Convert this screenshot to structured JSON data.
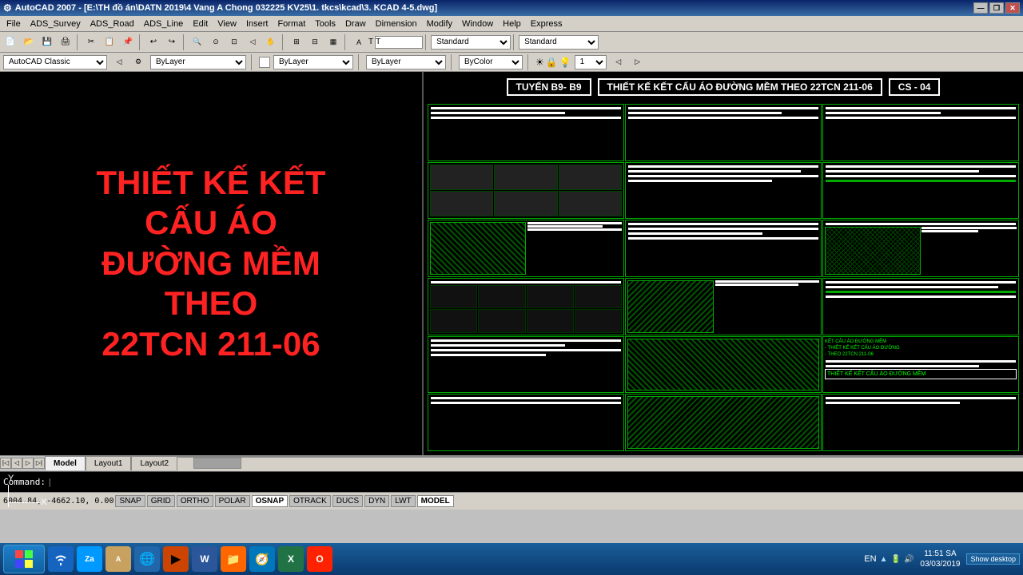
{
  "titlebar": {
    "title": "AutoCAD 2007 - [E:\\TH đồ án\\DATN 2019\\4 Vang A Chong 032225 KV25\\1. tkcs\\kcad\\3. KCAD 4-5.dwg]",
    "icon": "⚙",
    "min": "—",
    "max": "□",
    "close": "✕",
    "restore": "❐"
  },
  "menu": {
    "items": [
      "File",
      "ADS_Survey",
      "ADS_Road",
      "ADS_Line",
      "Edit",
      "View",
      "Insert",
      "Format",
      "Tools",
      "Draw",
      "Dimension",
      "Modify",
      "Window",
      "Help",
      "Express"
    ]
  },
  "toolbar1": {
    "buttons": [
      "📄",
      "📂",
      "💾",
      "🖨",
      "✂",
      "📋",
      "↩",
      "↪",
      "🔍",
      "❓"
    ]
  },
  "propbar": {
    "workspace": "AutoCAD Classic",
    "layer": "ByLayer",
    "color": "ByColor",
    "linetype": "ByLayer",
    "lineweight": "ByLayer",
    "plot": "1"
  },
  "drawing": {
    "left_text_lines": [
      "THIẾT KẾ KẾT",
      "CẤU ÁO",
      "ĐƯỜNG MỀM",
      "THEO",
      "22TCN 211-06"
    ],
    "header": {
      "badge1": "TUYẾN B9- B9",
      "title": "THIẾT KẾ KẾT CẤU ÁO ĐƯỜNG MỀM THEO 22TCN 211-06",
      "badge2": "CS - 04"
    }
  },
  "tabs": {
    "items": [
      "Model",
      "Layout1",
      "Layout2"
    ]
  },
  "cmdline": {
    "prompt": "Command:"
  },
  "statusbar": {
    "coords": "6004.84, -4662.10, 0.00",
    "buttons": [
      "SNAP",
      "GRID",
      "ORTHO",
      "POLAR",
      "OSNAP",
      "OTRACK",
      "DUCS",
      "DYN",
      "LWT",
      "MODEL"
    ]
  },
  "taskbar": {
    "win_icon": "⊞",
    "apps": [
      "wifi",
      "zalo",
      "recycle",
      "clock",
      "firefox",
      "vlc",
      "word",
      "finder",
      "safari",
      "excel",
      "opera"
    ],
    "time": "11:51 SA",
    "date": "03/03/2019",
    "lang": "EN",
    "show_desktop": "Show desktop"
  }
}
